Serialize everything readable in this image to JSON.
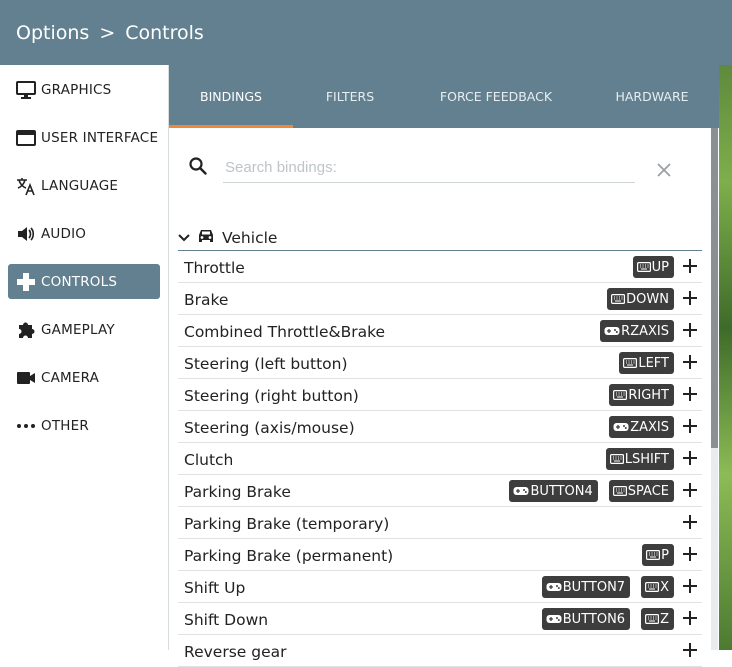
{
  "header": {
    "crumb_root": "Options",
    "crumb_sep": ">",
    "crumb_current": "Controls"
  },
  "sidebar": {
    "items": [
      {
        "label": "GRAPHICS",
        "icon": "monitor-icon"
      },
      {
        "label": "USER INTERFACE",
        "icon": "window-icon"
      },
      {
        "label": "LANGUAGE",
        "icon": "translate-icon"
      },
      {
        "label": "AUDIO",
        "icon": "speaker-icon"
      },
      {
        "label": "CONTROLS",
        "icon": "gamepad-icon",
        "active": true
      },
      {
        "label": "GAMEPLAY",
        "icon": "puzzle-icon"
      },
      {
        "label": "CAMERA",
        "icon": "camera-icon"
      },
      {
        "label": "OTHER",
        "icon": "more-dots-icon"
      }
    ]
  },
  "tabs": [
    {
      "label": "BINDINGS",
      "active": true
    },
    {
      "label": "FILTERS"
    },
    {
      "label": "FORCE FEEDBACK"
    },
    {
      "label": "HARDWARE"
    }
  ],
  "search": {
    "placeholder": "Search bindings:",
    "value": ""
  },
  "group": {
    "label": "Vehicle",
    "icon": "car-icon",
    "expanded": true
  },
  "bindings": [
    {
      "name": "Throttle",
      "binds": [
        {
          "device": "keyboard",
          "key": "UP"
        }
      ]
    },
    {
      "name": "Brake",
      "binds": [
        {
          "device": "keyboard",
          "key": "DOWN"
        }
      ]
    },
    {
      "name": "Combined Throttle&Brake",
      "binds": [
        {
          "device": "gamepad",
          "key": "RZAXIS"
        }
      ]
    },
    {
      "name": "Steering (left button)",
      "binds": [
        {
          "device": "keyboard",
          "key": "LEFT"
        }
      ]
    },
    {
      "name": "Steering (right button)",
      "binds": [
        {
          "device": "keyboard",
          "key": "RIGHT"
        }
      ]
    },
    {
      "name": "Steering (axis/mouse)",
      "binds": [
        {
          "device": "gamepad",
          "key": "ZAXIS"
        }
      ]
    },
    {
      "name": "Clutch",
      "binds": [
        {
          "device": "keyboard",
          "key": "LSHIFT"
        }
      ]
    },
    {
      "name": "Parking Brake",
      "binds": [
        {
          "device": "gamepad",
          "key": "BUTTON4"
        },
        {
          "device": "keyboard",
          "key": "SPACE"
        }
      ]
    },
    {
      "name": "Parking Brake (temporary)",
      "binds": []
    },
    {
      "name": "Parking Brake (permanent)",
      "binds": [
        {
          "device": "keyboard",
          "key": "P"
        }
      ]
    },
    {
      "name": "Shift Up",
      "binds": [
        {
          "device": "gamepad",
          "key": "BUTTON7"
        },
        {
          "device": "keyboard",
          "key": "X"
        }
      ]
    },
    {
      "name": "Shift Down",
      "binds": [
        {
          "device": "gamepad",
          "key": "BUTTON6"
        },
        {
          "device": "keyboard",
          "key": "Z"
        }
      ]
    },
    {
      "name": "Reverse gear",
      "binds": []
    }
  ],
  "colors": {
    "accent": "#62808f",
    "tab_underline": "#f0883a",
    "bind_chip": "#3d3d3d"
  }
}
